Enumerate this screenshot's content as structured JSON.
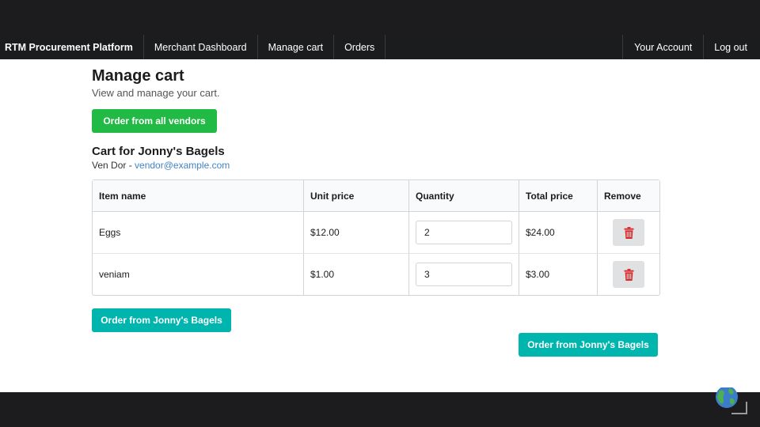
{
  "nav": {
    "brand": "RTM Procurement Platform",
    "items": [
      "Merchant Dashboard",
      "Manage cart",
      "Orders"
    ],
    "account": "Your Account",
    "logout": "Log out"
  },
  "page": {
    "title": "Manage cart",
    "subtitle": "View and manage your cart.",
    "order_all_label": "Order from all vendors"
  },
  "cart": {
    "title": "Cart for Jonny's Bagels",
    "vendor_name": "Ven Dor - ",
    "vendor_email": "vendor@example.com",
    "columns": [
      "Item name",
      "Unit price",
      "Quantity",
      "Total price",
      "Remove"
    ],
    "rows": [
      {
        "name": "Eggs",
        "unit_price": "$12.00",
        "quantity": "2",
        "total_price": "$24.00"
      },
      {
        "name": "veniam",
        "unit_price": "$1.00",
        "quantity": "3",
        "total_price": "$3.00"
      }
    ],
    "order_vendor_label": "Order from Jonny's Bagels",
    "order_vendor_label_2": "Order from Jonny's Bagels"
  },
  "colors": {
    "green": "#21ba45",
    "teal": "#00b5ad",
    "remove_red": "#db2828",
    "link": "#4183c4"
  },
  "icons": {
    "remove": "trash-icon",
    "corner": "globe-icon"
  }
}
